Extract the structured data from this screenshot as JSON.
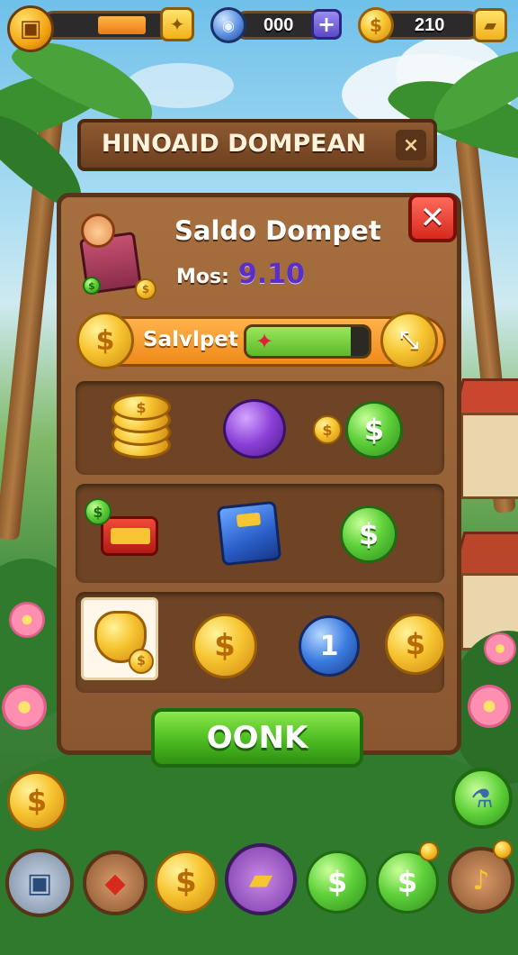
{
  "hud": {
    "gems_value": "000",
    "gems_add_icon": "plus-icon",
    "coins_value": "210",
    "energy_fill_percent": 66,
    "energy_button_icon": "lightning-icon",
    "coins_button_icon": "wallet-icon"
  },
  "dialog": {
    "title": "HINOAID DOMPEAN",
    "title_close_icon": "x-icon",
    "close_icon": "close-icon",
    "wallet_title": "Saldo Dompet",
    "balance_label": "Mos:",
    "balance_value": "9.10",
    "progress_label": "Salvlpet",
    "progress_fill_percent": 85,
    "progress_marker_icon": "star-marker-icon",
    "confirm_label": "OONK"
  },
  "rewards": {
    "row3_badge_text": "1"
  },
  "bottom_bar": {
    "items": [
      "backpack-icon",
      "gift-card-icon",
      "coin-icon",
      "shopping-bag-icon",
      "green-coin-icon",
      "green-coin-bonus-icon",
      "trumpet-icon"
    ]
  },
  "colors": {
    "accent_gold": "#f7c531",
    "accent_green": "#4cbb22",
    "wood": "#8a5630",
    "danger_red": "#e0332a",
    "balance_purple": "#5a2ec8"
  }
}
